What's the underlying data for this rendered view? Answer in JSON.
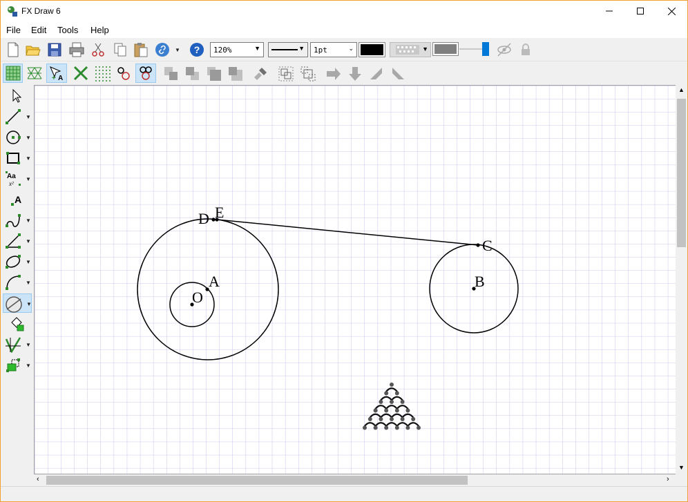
{
  "window": {
    "title": "FX Draw 6"
  },
  "menu": [
    "File",
    "Edit",
    "Tools",
    "Help"
  ],
  "toolbar": {
    "zoom": "120%",
    "line_width": "1pt",
    "line_color": "#000000",
    "fill_color": "#808080"
  },
  "toolbar_icons": [
    "new-icon",
    "open-icon",
    "save-icon",
    "print-icon",
    "cut-icon",
    "copy-icon",
    "paste-icon",
    "link-icon",
    "help-icon"
  ],
  "toolbar2_icons": [
    "grid-icon",
    "isometric-grid-icon",
    "add-point-label-icon",
    "delete-icon",
    "dot-grid-icon",
    "point-icon",
    "multi-point-icon",
    "bring-forward-icon",
    "send-backward-icon",
    "bring-to-front-icon",
    "send-to-back-icon",
    "format-painter-icon",
    "group-icon",
    "ungroup-icon",
    "arrow-right-icon",
    "arrow-down-icon",
    "rotate-left-icon",
    "rotate-right-icon"
  ],
  "left_tools": [
    "select-tool-icon",
    "line-tool-icon",
    "circle-tool-icon",
    "rectangle-tool-icon",
    "text-format-tool-icon",
    "text-tool-icon",
    "curve-tool-icon",
    "angle-tool-icon",
    "ellipse-tool-icon",
    "arc-tool-icon",
    "protractor-tool-icon",
    "fill-tool-icon",
    "graph-tool-icon",
    "shape-tool-icon"
  ],
  "drawing": {
    "labels": {
      "O": "O",
      "A": "A",
      "D": "D",
      "E": "E",
      "B": "B",
      "C": "C"
    }
  }
}
